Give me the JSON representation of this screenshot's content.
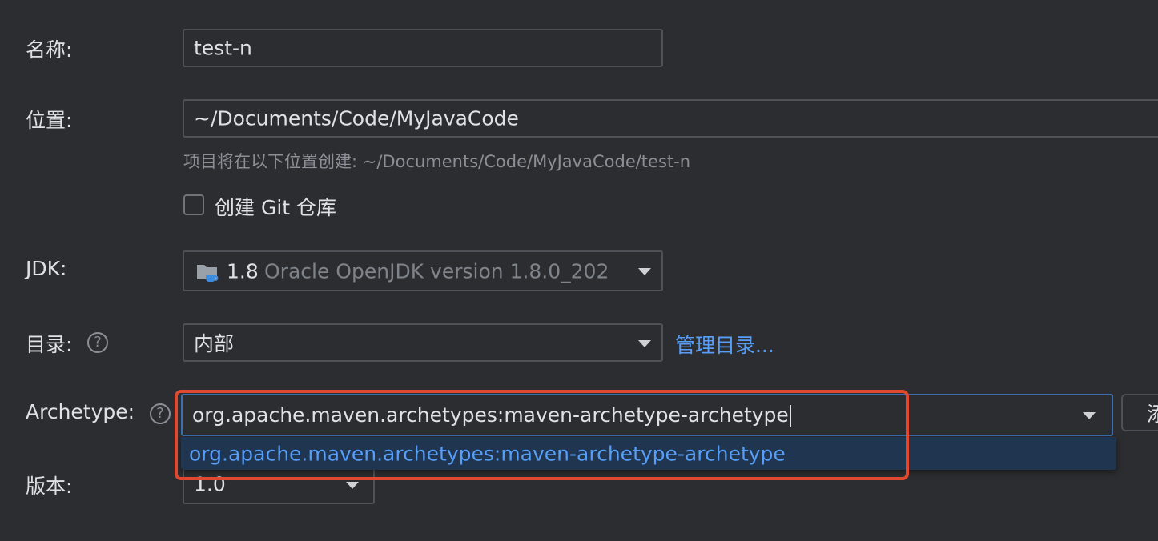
{
  "form": {
    "name": {
      "label": "名称:",
      "value": "test-n"
    },
    "location": {
      "label": "位置:",
      "value": "~/Documents/Code/MyJavaCode",
      "hint": "项目将在以下位置创建: ~/Documents/Code/MyJavaCode/test-n"
    },
    "git": {
      "label": "创建 Git 仓库",
      "checked": false
    },
    "jdk": {
      "label": "JDK:",
      "version": "1.8",
      "detail": "Oracle OpenJDK version 1.8.0_202"
    },
    "catalog": {
      "label": "目录:",
      "value": "内部",
      "manage_link": "管理目录..."
    },
    "archetype": {
      "label": "Archetype:",
      "value": "org.apache.maven.archetypes:maven-archetype-archetype",
      "suggestion": "org.apache.maven.archetypes:maven-archetype-archetype",
      "add_button": "添"
    },
    "version": {
      "label": "版本:",
      "value": "1.0"
    },
    "help_icon_text": "?"
  },
  "colors": {
    "background": "#2b2d30",
    "link": "#589df6",
    "highlight_border": "#e0482f",
    "selection_bg": "#1f3550",
    "focus_border": "#3d6fb3"
  },
  "icons": [
    "folder-icon",
    "help-icon",
    "chevron-down-icon"
  ]
}
